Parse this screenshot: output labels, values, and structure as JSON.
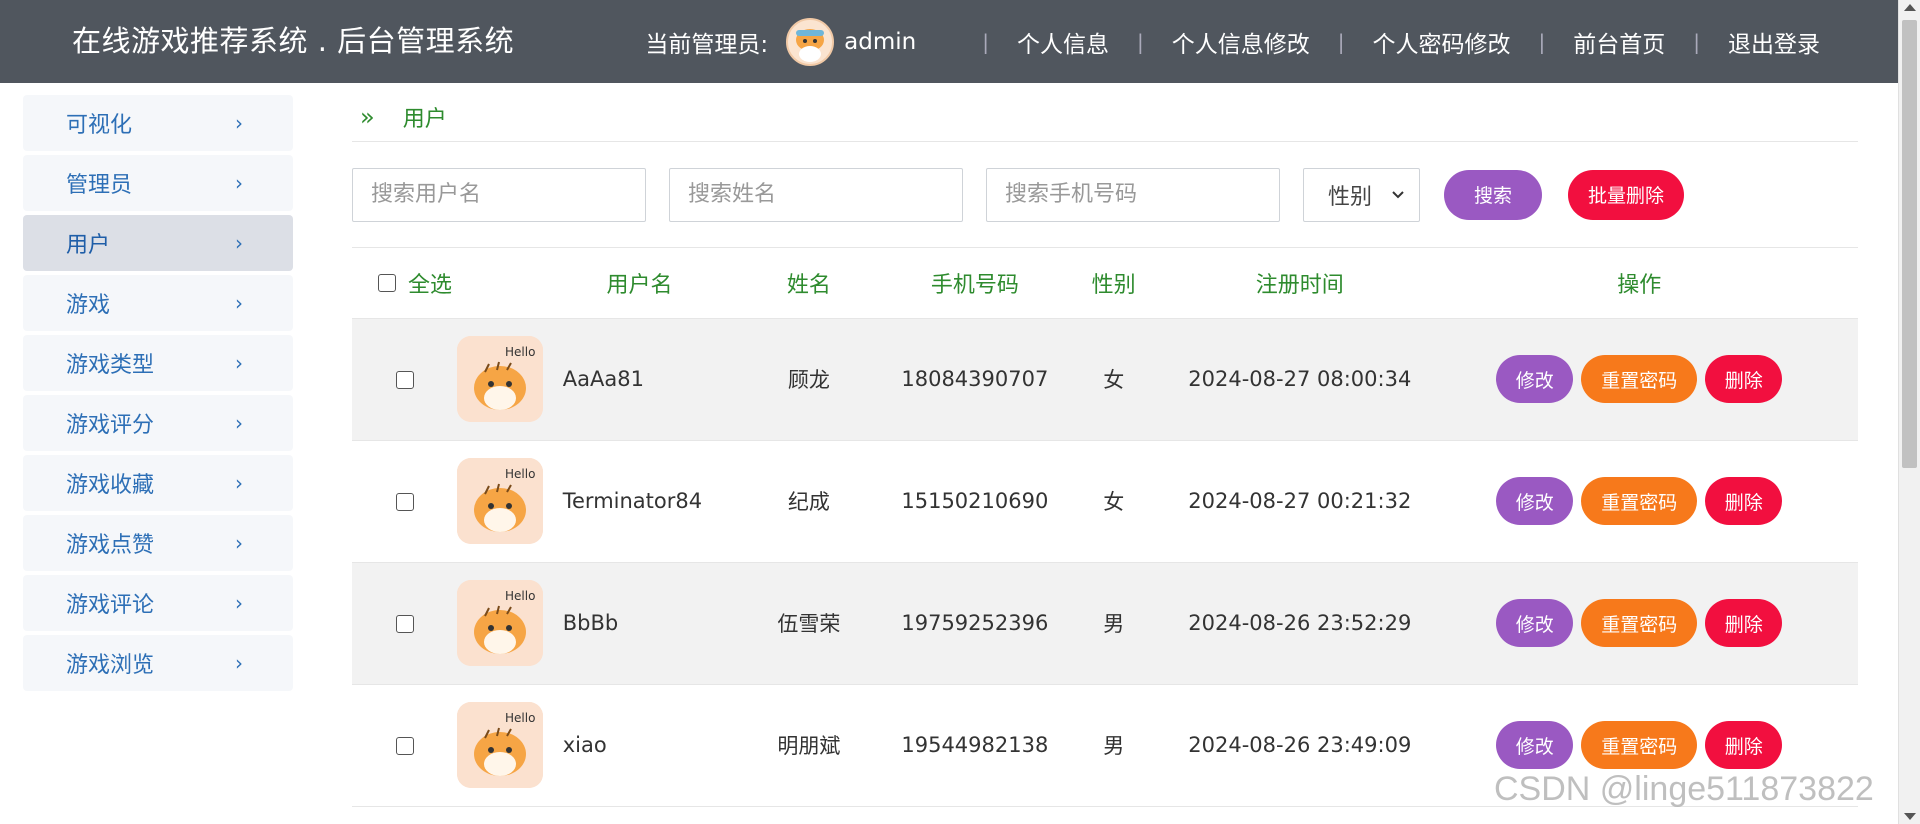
{
  "header": {
    "title": "在线游戏推荐系统 . 后台管理系统",
    "admin_label": "当前管理员:",
    "admin_name": "admin",
    "links": [
      "个人信息",
      "个人信息修改",
      "个人密码修改",
      "前台首页",
      "退出登录"
    ]
  },
  "sidebar": {
    "items": [
      {
        "label": "可视化"
      },
      {
        "label": "管理员"
      },
      {
        "label": "用户"
      },
      {
        "label": "游戏"
      },
      {
        "label": "游戏类型"
      },
      {
        "label": "游戏评分"
      },
      {
        "label": "游戏收藏"
      },
      {
        "label": "游戏点赞"
      },
      {
        "label": "游戏评论"
      },
      {
        "label": "游戏浏览"
      }
    ],
    "active": "用户"
  },
  "breadcrumb": {
    "icon": "»",
    "label": "用户"
  },
  "search": {
    "username_placeholder": "搜索用户名",
    "name_placeholder": "搜索姓名",
    "phone_placeholder": "搜索手机号码",
    "gender_select": "性别",
    "search_button": "搜索",
    "bulk_delete_button": "批量删除"
  },
  "table": {
    "columns": [
      "全选",
      "用户名",
      "姓名",
      "手机号码",
      "性别",
      "注册时间",
      "操作"
    ],
    "rows": [
      {
        "username": "AaAa81",
        "name": "顾龙",
        "phone": "18084390707",
        "gender": "女",
        "registered": "2024-08-27 08:00:34"
      },
      {
        "username": "Terminator84",
        "name": "纪成",
        "phone": "15150210690",
        "gender": "女",
        "registered": "2024-08-27 00:21:32"
      },
      {
        "username": "BbBb",
        "name": "伍雪荣",
        "phone": "19759252396",
        "gender": "男",
        "registered": "2024-08-26 23:52:29"
      },
      {
        "username": "xiao",
        "name": "明朋斌",
        "phone": "19544982138",
        "gender": "男",
        "registered": "2024-08-26 23:49:09"
      }
    ],
    "actions": {
      "edit": "修改",
      "reset": "重置密码",
      "delete": "删除"
    },
    "avatar_text": "Hello"
  },
  "watermark": "CSDN @linge511873822",
  "colors": {
    "header_bg": "#50565e",
    "accent_green": "#2e8b2e",
    "purple": "#9a59c2",
    "orange": "#f7791b",
    "red": "#f20f3f",
    "sidebar_text": "#2d6fb6"
  }
}
